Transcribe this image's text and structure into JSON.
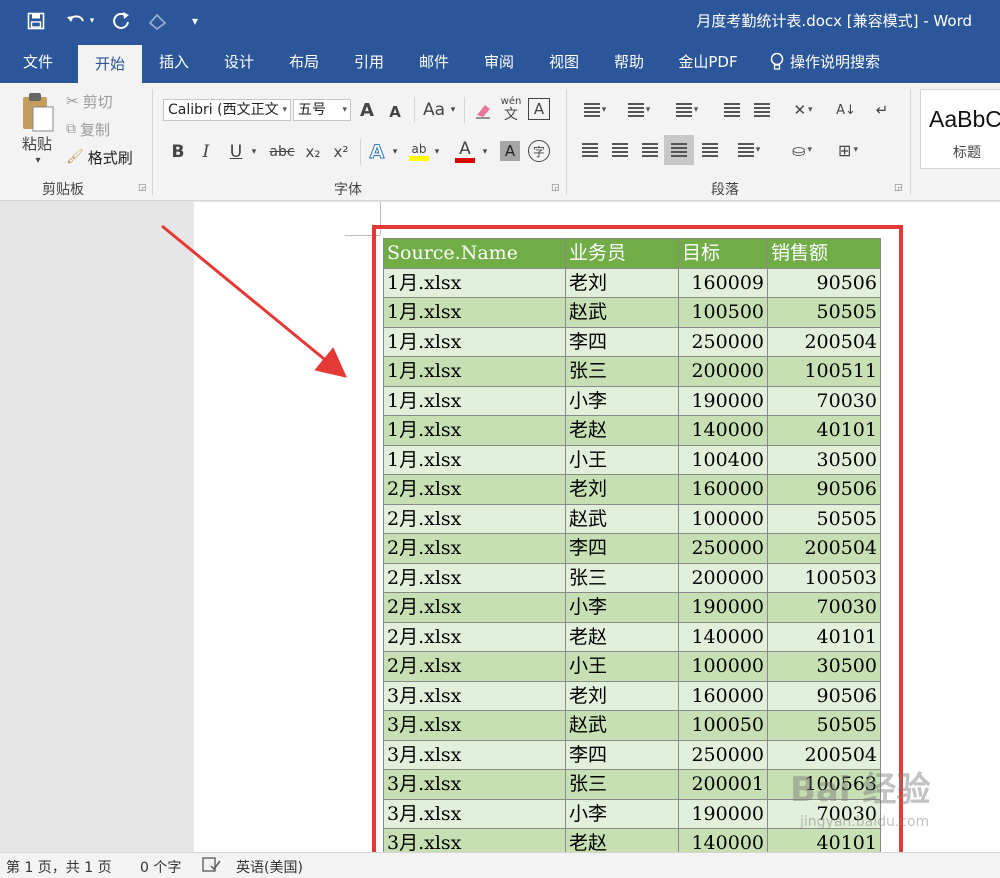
{
  "titlebar": {
    "title": "月度考勤统计表.docx [兼容模式]  -  Word",
    "qa_save_icon": "save-icon",
    "qa_undo_icon": "undo-icon",
    "qa_redo_icon": "redo-icon",
    "qa_touch_icon": "touch-mode-icon",
    "qa_customize_icon": "customize-qat-icon"
  },
  "tabs": [
    "文件",
    "开始",
    "插入",
    "设计",
    "布局",
    "引用",
    "邮件",
    "审阅",
    "视图",
    "帮助",
    "金山PDF",
    "操作说明搜索"
  ],
  "ribbon": {
    "clipboard": {
      "paste_label": "粘贴",
      "cut_label": "剪切",
      "copy_label": "复制",
      "format_painter_label": "格式刷",
      "group_label": "剪贴板"
    },
    "font": {
      "font_name": "Calibri (西文正文",
      "font_size": "五号",
      "grow_label": "A",
      "shrink_label": "A",
      "change_case_label": "Aa",
      "phonetic_label": "wén",
      "phonetic_sub_label": "文",
      "border_label": "A",
      "bold_label": "B",
      "italic_label": "I",
      "underline_label": "U",
      "strike_label": "abc",
      "subscript_label": "x₂",
      "superscript_label": "x²",
      "effects_label": "A",
      "highlight_label": "ab",
      "color_label": "A",
      "shading_label": "A",
      "enclose_label": "字",
      "group_label": "字体"
    },
    "paragraph": {
      "group_label": "段落"
    },
    "styles": {
      "preview_text": "AaBbC",
      "style_name": "标题"
    }
  },
  "table": {
    "headers": [
      "Source.Name",
      "业务员",
      "目标",
      "销售额"
    ],
    "rows": [
      [
        "1月.xlsx",
        "老刘",
        "160009",
        "90506"
      ],
      [
        "1月.xlsx",
        "赵武",
        "100500",
        "50505"
      ],
      [
        "1月.xlsx",
        "李四",
        "250000",
        "200504"
      ],
      [
        "1月.xlsx",
        "张三",
        "200000",
        "100511"
      ],
      [
        "1月.xlsx",
        "小李",
        "190000",
        "70030"
      ],
      [
        "1月.xlsx",
        "老赵",
        "140000",
        "40101"
      ],
      [
        "1月.xlsx",
        "小王",
        "100400",
        "30500"
      ],
      [
        "2月.xlsx",
        "老刘",
        "160000",
        "90506"
      ],
      [
        "2月.xlsx",
        "赵武",
        "100000",
        "50505"
      ],
      [
        "2月.xlsx",
        "李四",
        "250000",
        "200504"
      ],
      [
        "2月.xlsx",
        "张三",
        "200000",
        "100503"
      ],
      [
        "2月.xlsx",
        "小李",
        "190000",
        "70030"
      ],
      [
        "2月.xlsx",
        "老赵",
        "140000",
        "40101"
      ],
      [
        "2月.xlsx",
        "小王",
        "100000",
        "30500"
      ],
      [
        "3月.xlsx",
        "老刘",
        "160000",
        "90506"
      ],
      [
        "3月.xlsx",
        "赵武",
        "100050",
        "50505"
      ],
      [
        "3月.xlsx",
        "李四",
        "250000",
        "200504"
      ],
      [
        "3月.xlsx",
        "张三",
        "200001",
        "100563"
      ],
      [
        "3月.xlsx",
        "小李",
        "190000",
        "70030"
      ],
      [
        "3月.xlsx",
        "老赵",
        "140000",
        "40101"
      ]
    ]
  },
  "watermark": {
    "text": "Bai 经验",
    "sub": "jingyan.baidu.com"
  },
  "statusbar": {
    "page_info": "第 1 页，共 1 页",
    "word_count": "0 个字",
    "proofing_icon": "proofing-icon",
    "language": "英语(美国)"
  },
  "colors": {
    "word_blue": "#2b579a",
    "table_header": "#70ad47",
    "row_light": "#e2efda",
    "row_dark": "#c6e0b4",
    "annotation_red": "#e53935"
  }
}
